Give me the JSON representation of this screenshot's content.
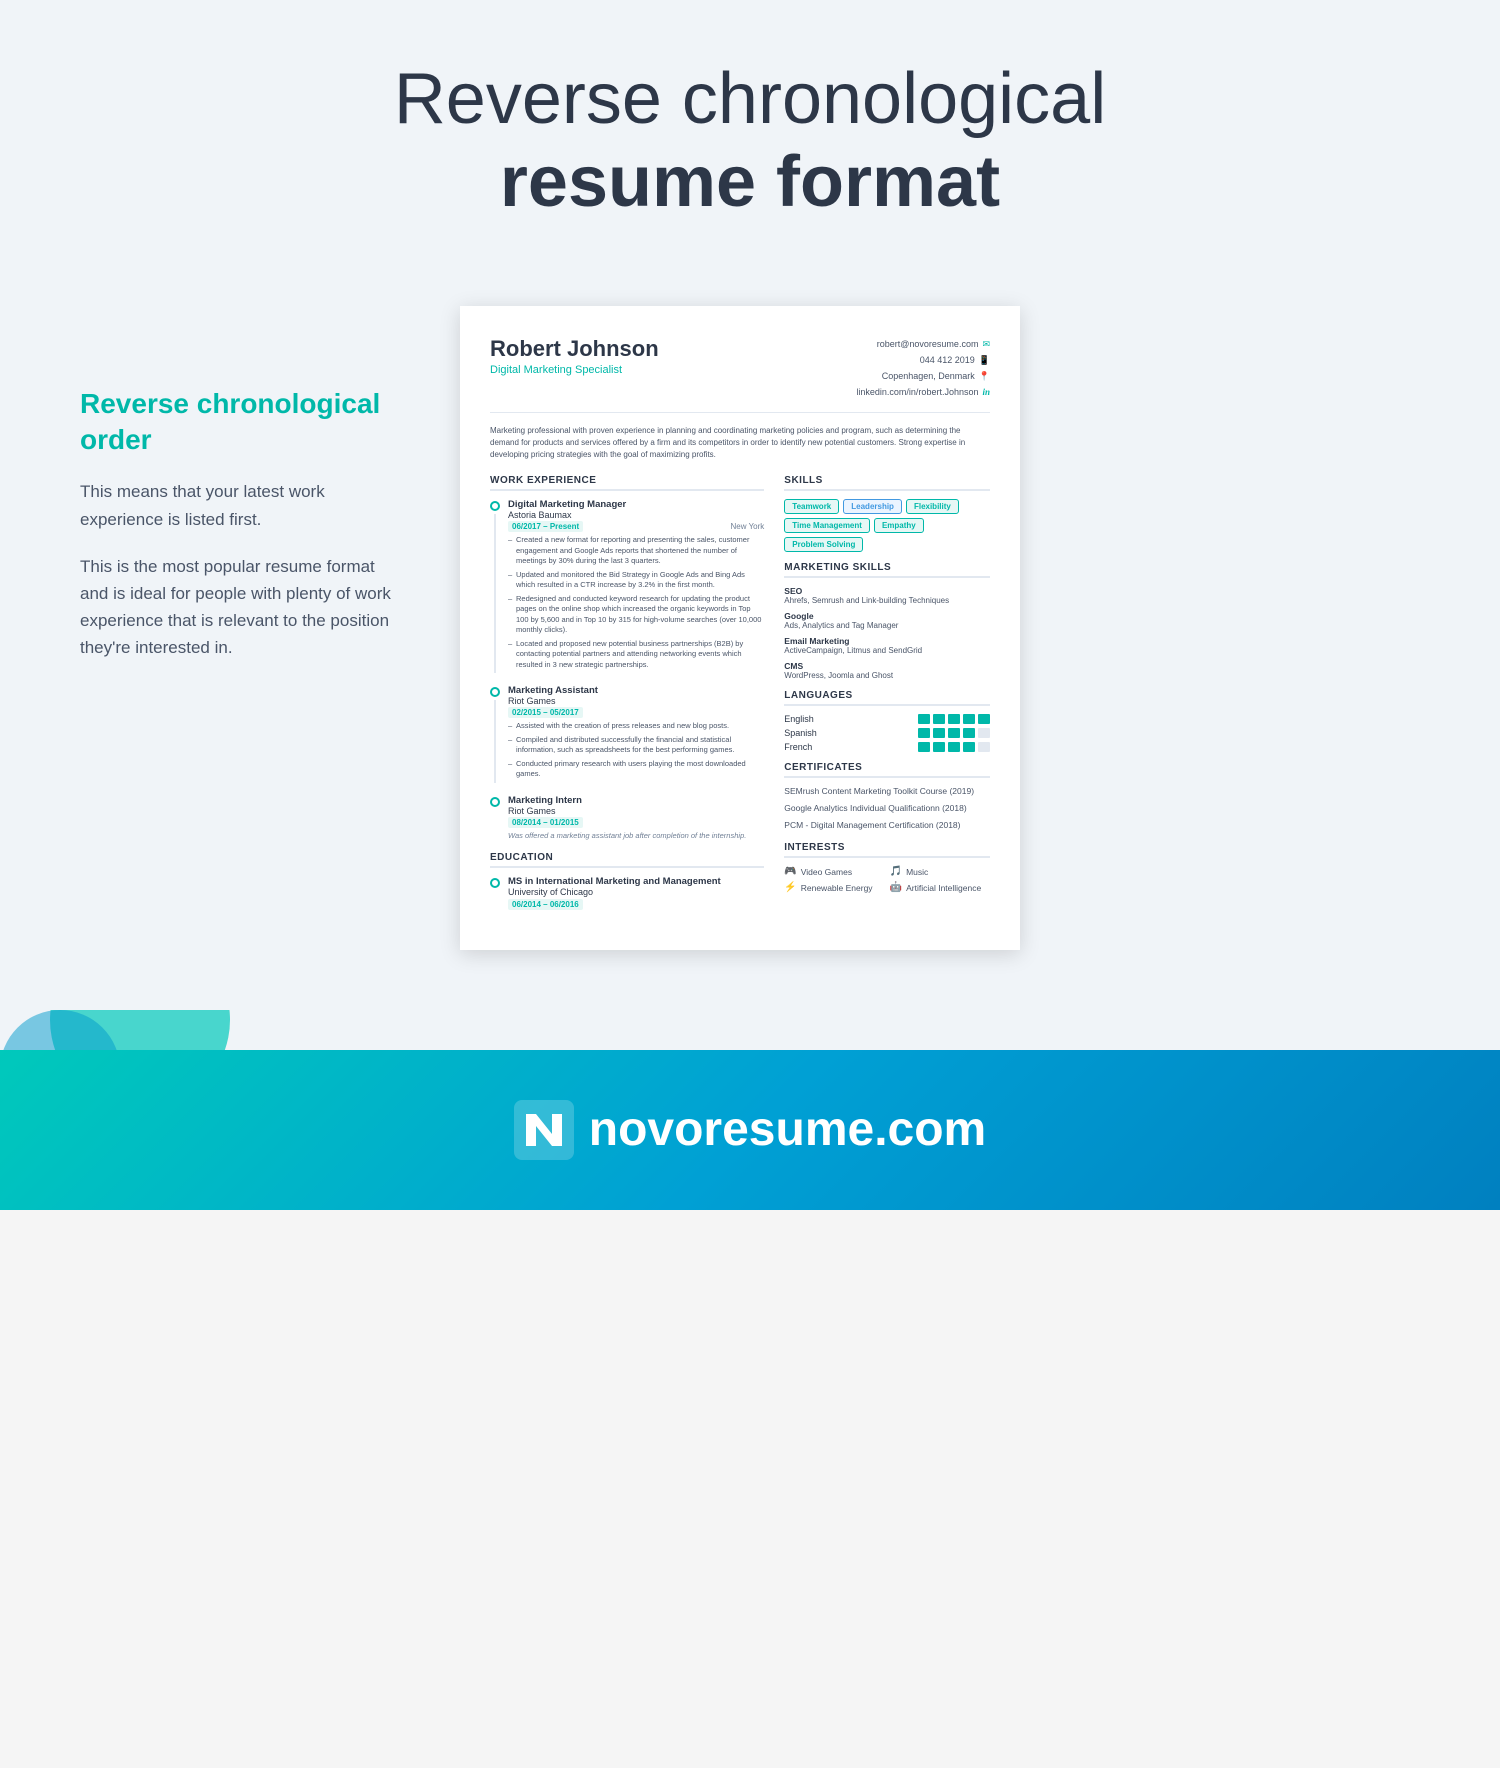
{
  "header": {
    "title_light": "Reverse chronological",
    "title_bold": "resume format"
  },
  "annotation": {
    "title": "Reverse chronological order",
    "para1": "This means that your latest work experience is listed first.",
    "para2": "This is the most popular resume format and is ideal for people with plenty of work experience that is relevant to the position they're interested in."
  },
  "resume": {
    "name": "Robert Johnson",
    "job_title": "Digital Marketing Specialist",
    "contact": {
      "email": "robert@novoresume.com",
      "phone": "044 412 2019",
      "location": "Copenhagen, Denmark",
      "linkedin": "linkedin.com/in/robert.Johnson"
    },
    "summary": "Marketing professional with proven experience in planning and coordinating marketing policies and program, such as determining the demand for products and services offered by a firm and its competitors in order to identify new potential customers. Strong expertise in developing pricing strategies with the goal of maximizing profits.",
    "work_experience_header": "WORK EXPERIENCE",
    "jobs": [
      {
        "title": "Digital Marketing Manager",
        "company": "Astoria Baumax",
        "dates": "06/2017 – Present",
        "location": "New York",
        "bullets": [
          "Created a new format for reporting and presenting the sales, customer engagement and Google Ads reports that shortened the number of meetings by 30% during the last 3 quarters.",
          "Updated and monitored the Bid Strategy in Google Ads and Bing Ads which resulted in a CTR increase by 3.2% in the first month.",
          "Redesigned and conducted keyword research for updating the product pages on the online shop which increased the organic keywords in Top 100 by 5,600 and in Top 10 by 315 for high-volume searches (over 10,000 monthly clicks).",
          "Located and proposed new potential business partnerships (B2B) by contacting potential partners and attending networking events which resulted in 3 new strategic partnerships."
        ],
        "note": ""
      },
      {
        "title": "Marketing Assistant",
        "company": "Riot Games",
        "dates": "02/2015 – 05/2017",
        "location": "",
        "bullets": [
          "Assisted with the creation of press releases and new blog posts.",
          "Compiled and distributed successfully the financial and statistical information, such as spreadsheets for the best performing games.",
          "Conducted primary research with users playing the most downloaded games."
        ],
        "note": ""
      },
      {
        "title": "Marketing Intern",
        "company": "Riot Games",
        "dates": "08/2014 – 01/2015",
        "location": "",
        "bullets": [],
        "note": "Was offered a marketing assistant job after completion of the internship."
      }
    ],
    "education_header": "EDUCATION",
    "education": [
      {
        "degree": "MS in International Marketing and Management",
        "school": "University of Chicago",
        "dates": "06/2014 – 06/2016"
      }
    ],
    "skills_header": "SKILLS",
    "skills_tags": [
      "Teamwork",
      "Leadership",
      "Flexibility",
      "Time Management",
      "Empathy",
      "Problem Solving"
    ],
    "marketing_skills_header": "MARKETING SKILLS",
    "marketing_skills": [
      {
        "name": "SEO",
        "detail": "Ahrefs, Semrush and Link-building Techniques"
      },
      {
        "name": "Google",
        "detail": "Ads, Analytics and Tag Manager"
      },
      {
        "name": "Email Marketing",
        "detail": "ActiveCampaign, Litmus and SendGrid"
      },
      {
        "name": "CMS",
        "detail": "WordPress, Joomla and Ghost"
      }
    ],
    "languages_header": "LANGUAGES",
    "languages": [
      {
        "name": "English",
        "level": 5
      },
      {
        "name": "Spanish",
        "level": 4
      },
      {
        "name": "French",
        "level": 4
      }
    ],
    "certificates_header": "CERTIFICATES",
    "certificates": [
      "SEMrush Content Marketing Toolkit Course (2019)",
      "Google Analytics Individual Qualificationn (2018)",
      "PCM - Digital Management Certification (2018)"
    ],
    "interests_header": "INTERESTS",
    "interests": [
      {
        "icon": "🎮",
        "name": "Video Games"
      },
      {
        "icon": "🎵",
        "name": "Music"
      },
      {
        "icon": "⚡",
        "name": "Renewable Energy"
      },
      {
        "icon": "🤖",
        "name": "Artificial Intelligence"
      }
    ]
  },
  "brand": {
    "name": "novoresume.com"
  }
}
